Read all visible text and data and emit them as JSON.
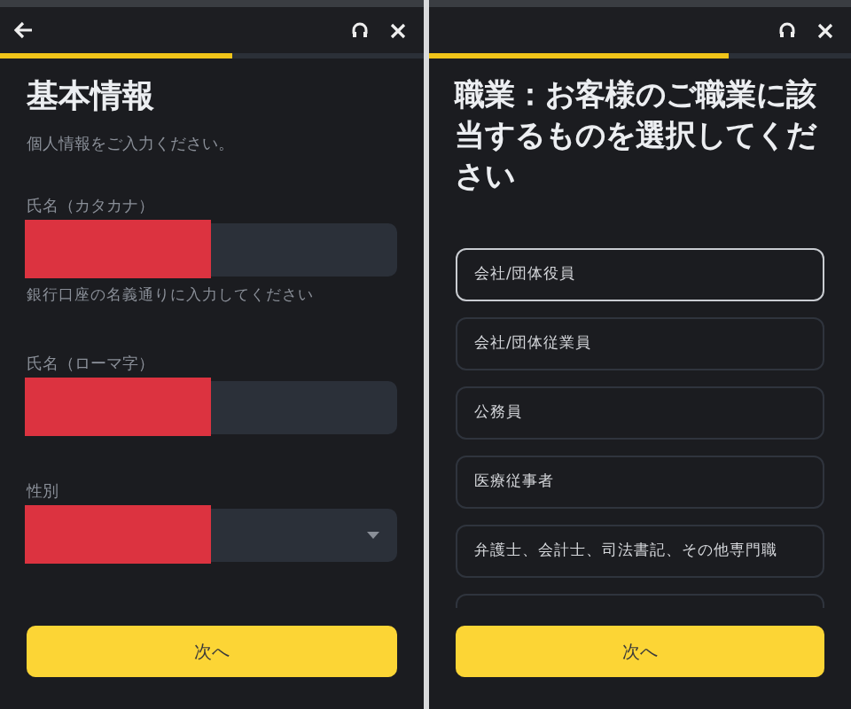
{
  "screens": [
    {
      "kind": "form",
      "header": {
        "back": true
      },
      "progress": {
        "level": 0.55
      },
      "title": "基本情報",
      "subtitle": "個人情報をご入力ください。",
      "fields": [
        {
          "kind": "text",
          "label": "氏名（カタカナ）",
          "redacted": true,
          "hint": "銀行口座の名義通りに入力してください"
        },
        {
          "kind": "text",
          "label": "氏名（ローマ字）",
          "redacted": true
        },
        {
          "kind": "select",
          "label": "性別",
          "redacted": true
        }
      ],
      "button": "次へ"
    },
    {
      "kind": "choice",
      "header": {
        "back": false
      },
      "progress": {
        "level": 0.71
      },
      "title": "職業：お客様のご職業に該当するものを選択してください",
      "options": [
        {
          "label": "会社/団体役員",
          "selected": true
        },
        {
          "label": "会社/団体従業員",
          "selected": false
        },
        {
          "label": "公務員",
          "selected": false
        },
        {
          "label": "医療従事者",
          "selected": false
        },
        {
          "label": "弁護士、会計士、司法書記、その他専門職",
          "selected": false
        },
        {
          "selected": false
        }
      ],
      "button": "次へ"
    }
  ]
}
